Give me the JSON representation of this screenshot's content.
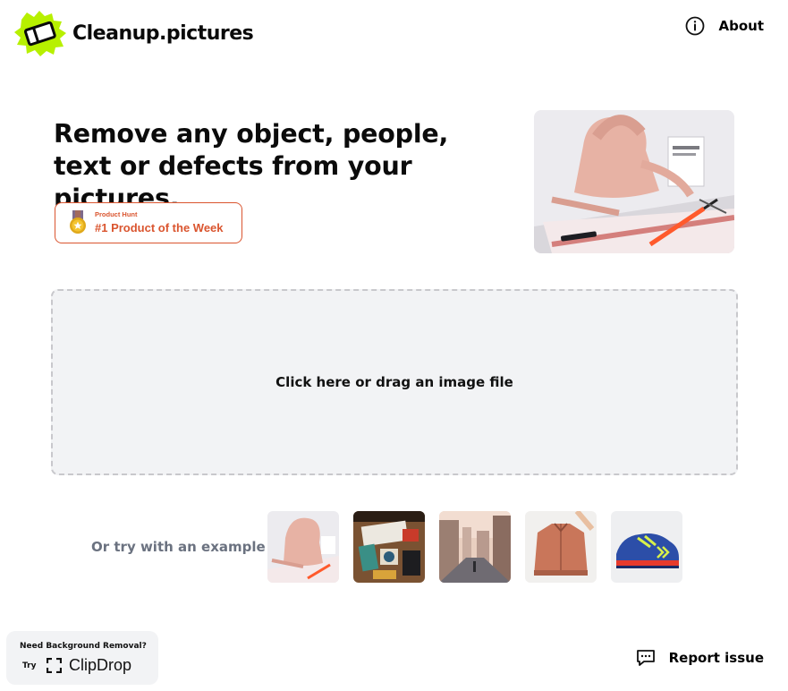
{
  "header": {
    "app_name": "Cleanup.pictures",
    "logo_icon": "eraser-icon",
    "about_label": "About",
    "about_icon": "info-icon"
  },
  "hero": {
    "title": "Remove any object, people, text or defects from your pictures.",
    "badge": {
      "small_text": "Product Hunt",
      "big_text": "#1 Product of the Week",
      "icon": "medal-icon",
      "color": "#da552f"
    },
    "image_subject": "pink handbag with tools"
  },
  "dropzone": {
    "label": "Click here or drag an image file"
  },
  "examples": {
    "label": "Or try with an example",
    "items": [
      {
        "subject": "pink bag"
      },
      {
        "subject": "desk objects"
      },
      {
        "subject": "city street"
      },
      {
        "subject": "jacket on hanger"
      },
      {
        "subject": "blue sneaker"
      }
    ]
  },
  "footer": {
    "clipdrop_prompt": "Need Background Removal?",
    "clipdrop_try": "Try",
    "clipdrop_name": "ClipDrop",
    "clipdrop_icon": "clipdrop-icon",
    "report_label": "Report issue",
    "report_icon": "message-icon"
  },
  "colors": {
    "brand_green": "#b7f000",
    "producthunt": "#da552f",
    "dropzone_bg": "#f2f3f5",
    "muted_text": "#6b7280"
  }
}
